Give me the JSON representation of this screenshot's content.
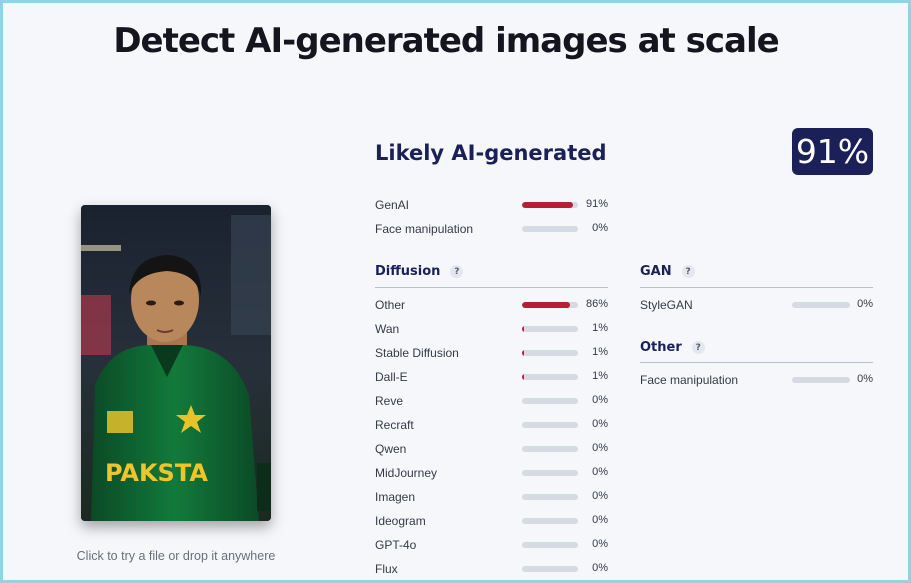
{
  "headline": "Detect AI-generated images at scale",
  "drop_hint": "Click to try a file or drop it anywhere",
  "image": {
    "jersey_text": "PAKSTA"
  },
  "result": {
    "verdict": "Likely AI-generated",
    "score": "91%",
    "bar_color": "#b51f34",
    "track_color": "#d5dae3",
    "summary": [
      {
        "label": "GenAI",
        "percent": "91%",
        "value": 0.91
      },
      {
        "label": "Face manipulation",
        "percent": "0%",
        "value": 0
      }
    ],
    "diffusion": {
      "title": "Diffusion",
      "help_icon": "?",
      "items": [
        {
          "label": "Other",
          "percent": "86%",
          "value": 0.86
        },
        {
          "label": "Wan",
          "percent": "1%",
          "value": 0.01
        },
        {
          "label": "Stable Diffusion",
          "percent": "1%",
          "value": 0.01
        },
        {
          "label": "Dall-E",
          "percent": "1%",
          "value": 0.01
        },
        {
          "label": "Reve",
          "percent": "0%",
          "value": 0
        },
        {
          "label": "Recraft",
          "percent": "0%",
          "value": 0
        },
        {
          "label": "Qwen",
          "percent": "0%",
          "value": 0
        },
        {
          "label": "MidJourney",
          "percent": "0%",
          "value": 0
        },
        {
          "label": "Imagen",
          "percent": "0%",
          "value": 0
        },
        {
          "label": "Ideogram",
          "percent": "0%",
          "value": 0
        },
        {
          "label": "GPT-4o",
          "percent": "0%",
          "value": 0
        },
        {
          "label": "Flux",
          "percent": "0%",
          "value": 0
        }
      ]
    },
    "gan": {
      "title": "GAN",
      "help_icon": "?",
      "items": [
        {
          "label": "StyleGAN",
          "percent": "0%",
          "value": 0
        }
      ]
    },
    "other": {
      "title": "Other",
      "help_icon": "?",
      "items": [
        {
          "label": "Face manipulation",
          "percent": "0%",
          "value": 0
        }
      ]
    }
  }
}
